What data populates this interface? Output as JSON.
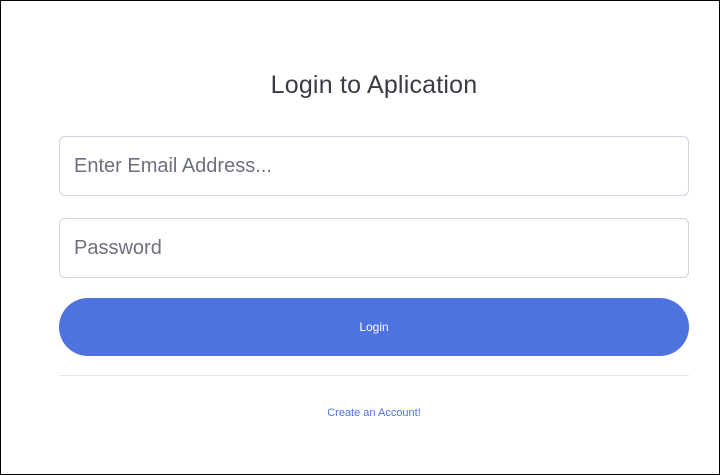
{
  "login_card": {
    "title": "Login to Aplication",
    "email_placeholder": "Enter Email Address...",
    "password_placeholder": "Password",
    "login_label": "Login",
    "create_account_label": "Create an Account!"
  },
  "colors": {
    "primary": "#4e73df",
    "border": "#d1d3e2",
    "text": "#3a3b45"
  }
}
